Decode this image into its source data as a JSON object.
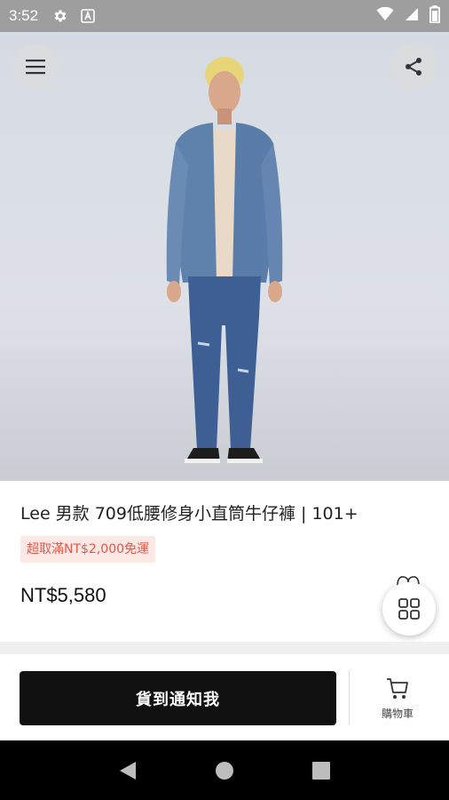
{
  "status_bar": {
    "time": "3:52",
    "icons": [
      "settings-icon",
      "a-letter-icon",
      "wifi-icon",
      "signal-icon",
      "battery-icon"
    ]
  },
  "hero": {
    "menu_icon": "hamburger-icon",
    "share_icon": "share-icon"
  },
  "product": {
    "title": "Lee 男款 709低腰修身小直筒牛仔褲 | 101+",
    "promo": "超取滿NT$2,000免運",
    "price": "NT$5,580"
  },
  "fab": {
    "icon": "grid-icon"
  },
  "bottom_bar": {
    "notify_label": "貨到通知我",
    "cart_label": "購物車"
  },
  "colors": {
    "promo_text": "#e05a4a",
    "promo_bg": "#fde8e6",
    "button_bg": "#111111",
    "status_bar": "#9e9e9e"
  },
  "nav_bar": {
    "buttons": [
      "back-icon",
      "home-icon",
      "recents-icon"
    ]
  }
}
